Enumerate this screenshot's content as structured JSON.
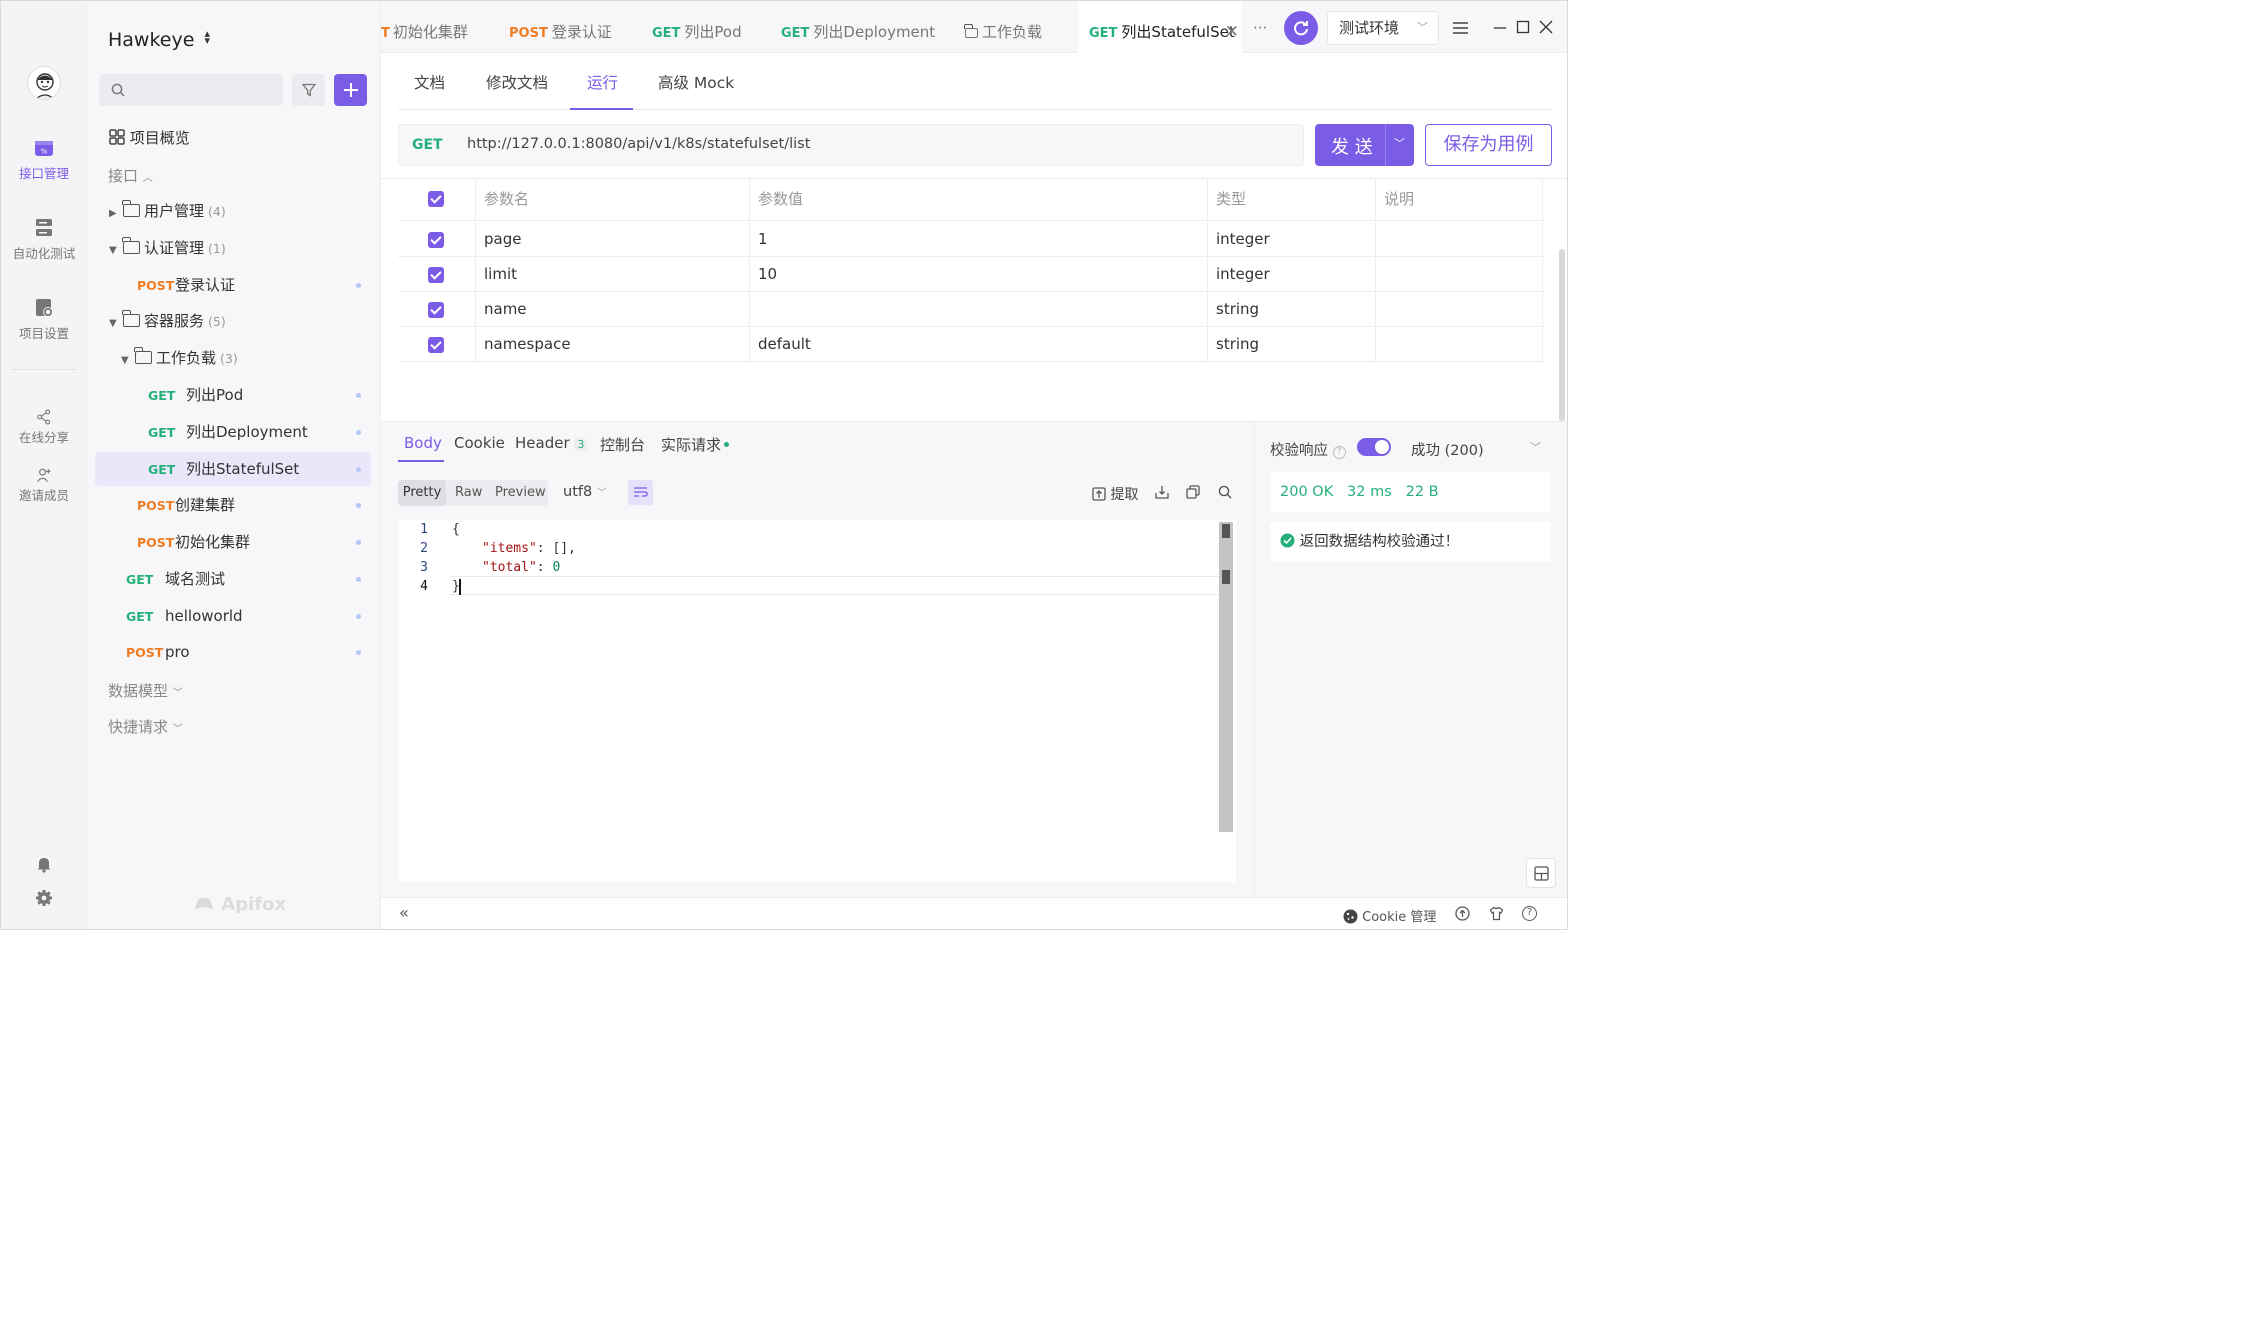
{
  "app": {
    "project": "Hawkeye",
    "brand": "Apifox"
  },
  "rail": {
    "items": [
      {
        "label": "接口管理",
        "icon": "api-icon",
        "active": true
      },
      {
        "label": "自动化测试",
        "icon": "automation-icon"
      },
      {
        "label": "项目设置",
        "icon": "settings-doc-icon"
      },
      {
        "label": "在线分享",
        "icon": "share-icon"
      },
      {
        "label": "邀请成员",
        "icon": "invite-icon"
      }
    ]
  },
  "sidebar": {
    "overview": "项目概览",
    "interfaces": "接口",
    "groups": {
      "user": {
        "name": "用户管理",
        "count": "(4)"
      },
      "auth": {
        "name": "认证管理",
        "count": "(1)"
      },
      "container": {
        "name": "容器服务",
        "count": "(5)"
      },
      "workload": {
        "name": "工作负载",
        "count": "(3)"
      }
    },
    "items": [
      {
        "method": "POST",
        "name": "登录认证"
      },
      {
        "method": "GET",
        "name": "列出Pod"
      },
      {
        "method": "GET",
        "name": "列出Deployment"
      },
      {
        "method": "GET",
        "name": "列出StatefulSet"
      },
      {
        "method": "POST",
        "name": "创建集群"
      },
      {
        "method": "POST",
        "name": "初始化集群"
      },
      {
        "method": "GET",
        "name": "域名测试"
      },
      {
        "method": "GET",
        "name": "helloworld"
      },
      {
        "method": "POST",
        "name": "pro"
      }
    ],
    "data_models": "数据模型",
    "quick_requests": "快捷请求"
  },
  "tabs": [
    {
      "method": "T",
      "name": "初始化集群"
    },
    {
      "method": "POST",
      "name": "登录认证"
    },
    {
      "method": "GET",
      "name": "列出Pod"
    },
    {
      "method": "GET",
      "name": "列出Deployment"
    },
    {
      "method": "",
      "name": "工作负载"
    },
    {
      "method": "GET",
      "name": "列出StatefulSet"
    }
  ],
  "toolbar": {
    "more": "···",
    "environment": "测试环境"
  },
  "subtabs": [
    "文档",
    "修改文档",
    "运行",
    "高级 Mock"
  ],
  "request": {
    "method": "GET",
    "url": "http://127.0.0.1:8080/api/v1/k8s/statefulset/list",
    "send_label": "发 送",
    "save_label": "保存为用例"
  },
  "params": {
    "headers": [
      "参数名",
      "参数值",
      "类型",
      "说明"
    ],
    "rows": [
      {
        "name": "page",
        "value": "1",
        "type": "integer"
      },
      {
        "name": "limit",
        "value": "10",
        "type": "integer"
      },
      {
        "name": "name",
        "value": "",
        "type": "string"
      },
      {
        "name": "namespace",
        "value": "default",
        "type": "string"
      }
    ]
  },
  "response": {
    "tabs": [
      "Body",
      "Cookie",
      "Header",
      "控制台",
      "实际请求"
    ],
    "header_count": "3",
    "views": [
      "Pretty",
      "Raw",
      "Preview"
    ],
    "encoding": "utf8",
    "extract": "提取",
    "lines": [
      "1",
      "2",
      "3",
      "4"
    ],
    "code": {
      "open": "{",
      "k1": "\"items\"",
      "v1": ": [],",
      "k2": "\"total\"",
      "v2": "0",
      "close": "}"
    }
  },
  "validation": {
    "label": "校验响应",
    "status_select": "成功 (200)",
    "status": "200 OK",
    "time": "32 ms",
    "size": "22 B",
    "message": "返回数据结构校验通过！"
  },
  "footer": {
    "cookie": "Cookie 管理"
  },
  "colors": {
    "accent": "#7b5ce6",
    "get": "#25b07a",
    "post": "#f07c22"
  }
}
